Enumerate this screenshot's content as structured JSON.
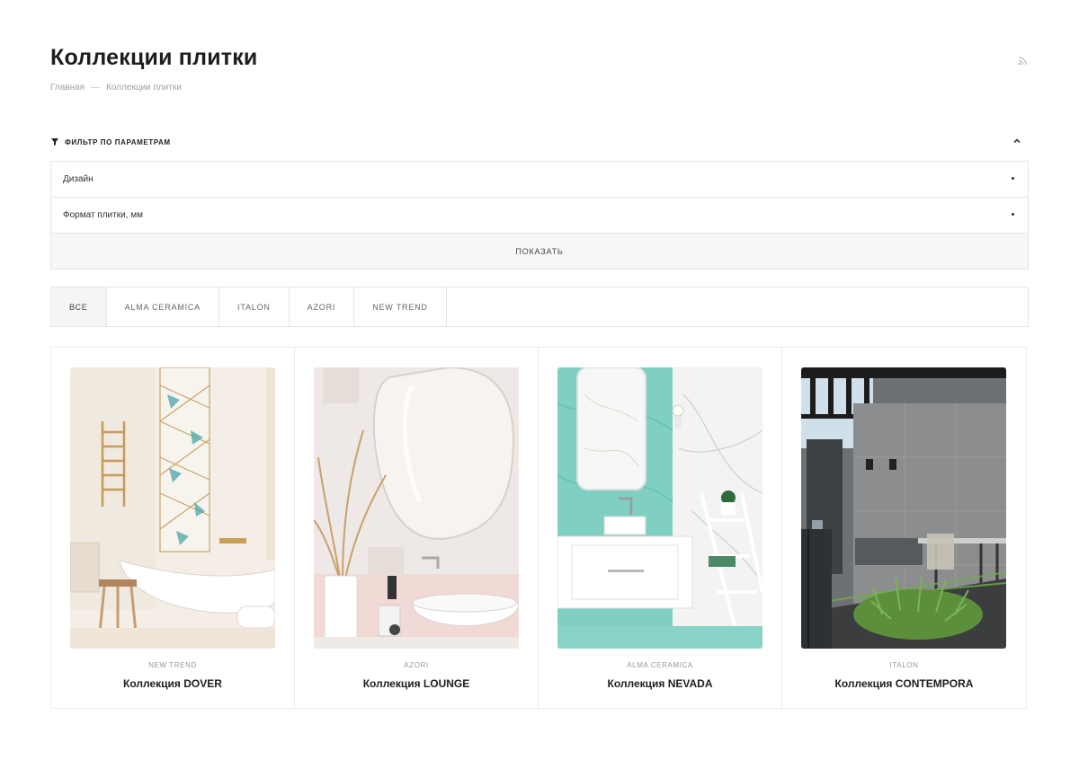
{
  "header": {
    "title": "Коллекции плитки",
    "rss_icon": "rss-icon"
  },
  "breadcrumb": {
    "items": [
      "Главная",
      "Коллекции плитки"
    ],
    "separator": "—"
  },
  "filter": {
    "title": "ФИЛЬТР ПО ПАРАМЕТРАМ",
    "icon": "funnel-icon",
    "toggle_icon": "chevron-up-icon",
    "fields": [
      {
        "label": "Дизайн"
      },
      {
        "label": "Формат плитки, мм"
      }
    ],
    "show_button": "ПОКАЗАТЬ"
  },
  "tabs": {
    "items": [
      "ВСЕ",
      "ALMA CERAMICA",
      "ITALON",
      "AZORI",
      "NEW TREND"
    ],
    "active": "ВСЕ"
  },
  "collections": [
    {
      "brand": "NEW TREND",
      "name": "Коллекция DOVER"
    },
    {
      "brand": "AZORI",
      "name": "Коллекция LOUNGE"
    },
    {
      "brand": "ALMA CERAMICA",
      "name": "Коллекция NEVADA"
    },
    {
      "brand": "ITALON",
      "name": "Коллекция CONTEMPORA"
    }
  ],
  "colors": {
    "text_dark": "#1e1e1e",
    "muted": "#a0a0a0",
    "border": "#e6e6e6",
    "button_bg": "#f7f7f7"
  }
}
